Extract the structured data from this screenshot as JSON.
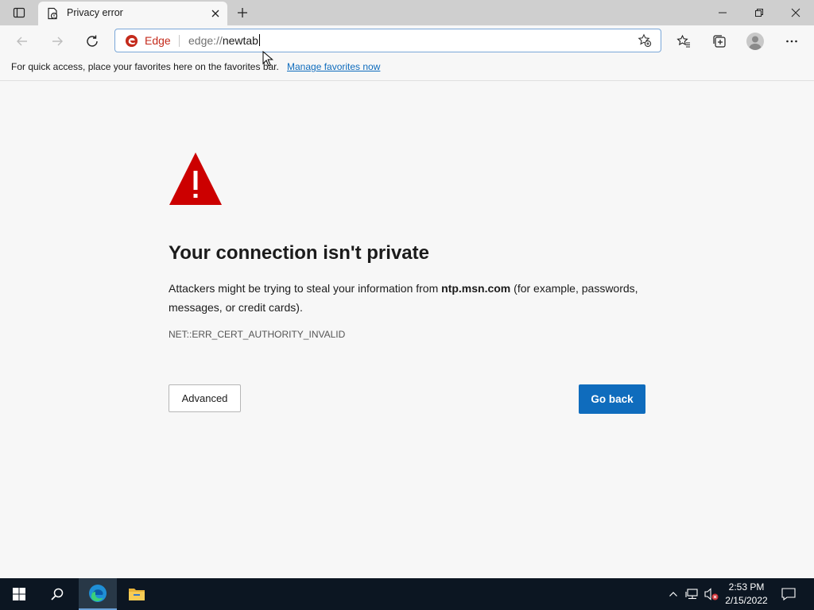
{
  "tab": {
    "title": "Privacy error"
  },
  "omnibox": {
    "badge_label": "Edge",
    "scheme": "edge://",
    "path": "newtab"
  },
  "favorites_bar": {
    "message": "For quick access, place your favorites here on the favorites bar.",
    "link": "Manage favorites now"
  },
  "error_page": {
    "heading": "Your connection isn't private",
    "body_prefix": "Attackers might be trying to steal your information from ",
    "host": "ntp.msn.com",
    "body_suffix": " (for example, passwords, messages, or credit cards).",
    "error_code": "NET::ERR_CERT_AUTHORITY_INVALID",
    "advanced_button": "Advanced",
    "go_back_button": "Go back"
  },
  "taskbar": {
    "time": "2:53 PM",
    "date": "2/15/2022"
  },
  "colors": {
    "accent": "#0f6cbd",
    "warning": "#cc0000",
    "edge_badge": "#c42b1c",
    "taskbar": "#0c1622"
  }
}
